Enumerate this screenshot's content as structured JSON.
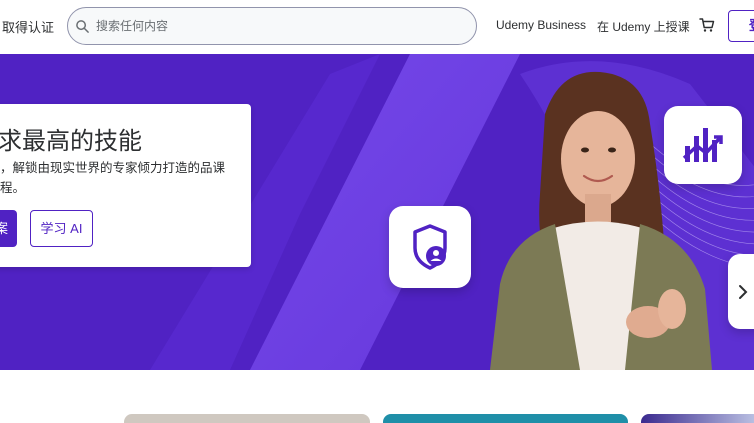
{
  "header": {
    "explore_label": "取得认证",
    "search": {
      "placeholder": "搜索任何内容",
      "value": ""
    },
    "links": {
      "business": "Udemy Business",
      "teach": "在 Udemy 上授课"
    },
    "login_label": "登"
  },
  "hero": {
    "title": "求最高的技能",
    "subtitle": "，解锁由现实世界的专家倾力打造的品课程。",
    "primary_button": "案",
    "secondary_button": "学习 AI"
  },
  "icons": [
    "search-icon",
    "cart-icon",
    "shield-user-icon",
    "chart-growth-icon",
    "arrow-right-icon"
  ],
  "colors": {
    "brand": "#5022c3",
    "hero_bg": "#5022c3",
    "text": "#2d2f31",
    "accent_purple": "#6d28d2"
  }
}
